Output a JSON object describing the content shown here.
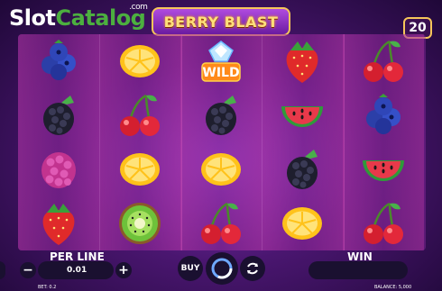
{
  "watermark": {
    "part1": "Slot",
    "part2": "Catalog",
    "suffix": ".com"
  },
  "game": {
    "title": "BERRY BLAST",
    "lines": "20"
  },
  "reels": [
    [
      "blueberry-icon",
      "blackberry-icon",
      "raspberry-icon",
      "strawberry-icon"
    ],
    [
      "lemon-icon",
      "cherry-icon",
      "lemon-icon",
      "kiwi-icon"
    ],
    [
      "wild-icon",
      "blackberry-icon",
      "lemon-icon",
      "cherry-icon"
    ],
    [
      "strawberry-icon",
      "watermelon-icon",
      "blackberry-icon",
      "lemon-icon"
    ],
    [
      "cherry-icon",
      "blueberry-icon",
      "watermelon-icon",
      "cherry-icon"
    ]
  ],
  "wild_label": "WILD",
  "controls": {
    "per_line_label": "PER LINE",
    "per_line_value": "0.01",
    "minus": "−",
    "plus": "+",
    "buy_label": "BUY",
    "win_label": "WIN",
    "win_value": "",
    "bet_text": "BET: 0.2",
    "balance_text": "BALANCE: 5,000"
  },
  "colors": {
    "frame": "#f6c65a",
    "brand_green": "#4caf3f",
    "background": "#4a1670"
  }
}
